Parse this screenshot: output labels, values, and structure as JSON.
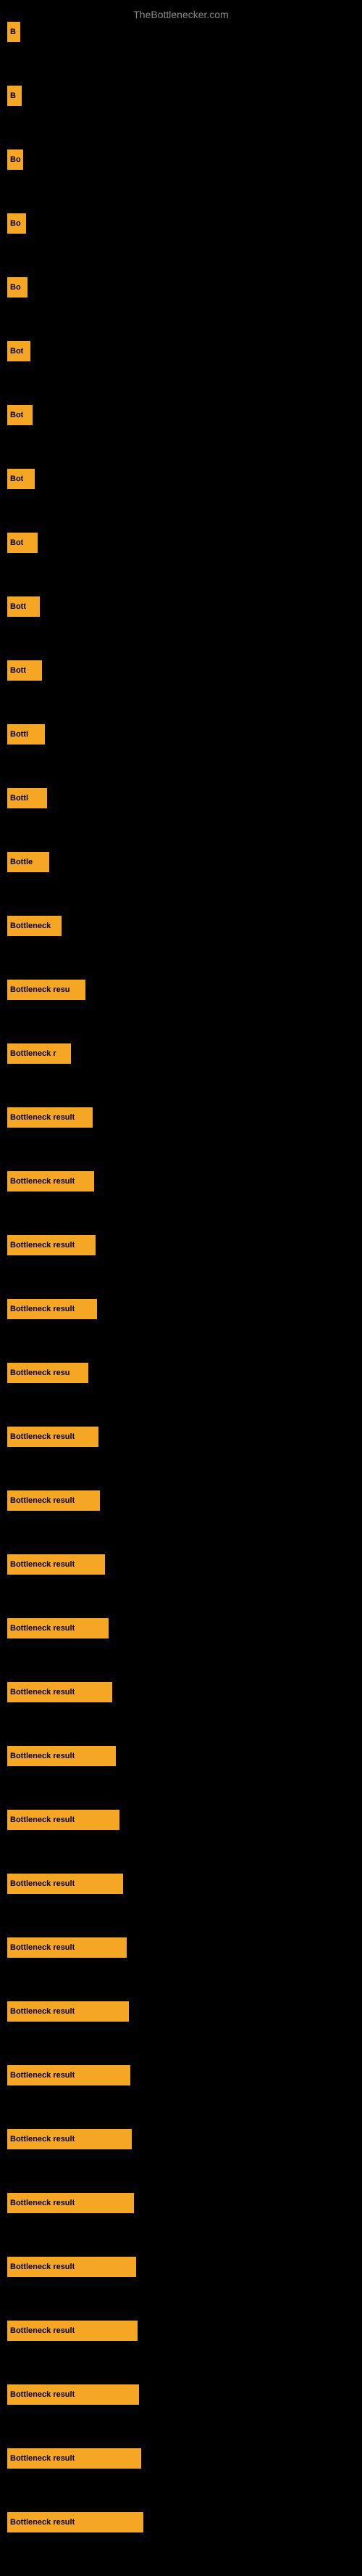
{
  "site": {
    "title": "TheBottlenecker.com"
  },
  "bars": [
    {
      "label": "B",
      "width": 18
    },
    {
      "label": "B",
      "width": 20
    },
    {
      "label": "Bo",
      "width": 22
    },
    {
      "label": "Bo",
      "width": 26
    },
    {
      "label": "Bo",
      "width": 28
    },
    {
      "label": "Bot",
      "width": 32
    },
    {
      "label": "Bot",
      "width": 35
    },
    {
      "label": "Bot",
      "width": 38
    },
    {
      "label": "Bot",
      "width": 42
    },
    {
      "label": "Bott",
      "width": 45
    },
    {
      "label": "Bott",
      "width": 48
    },
    {
      "label": "Bottl",
      "width": 52
    },
    {
      "label": "Bottl",
      "width": 55
    },
    {
      "label": "Bottle",
      "width": 58
    },
    {
      "label": "Bottleneck",
      "width": 75
    },
    {
      "label": "Bottleneck resu",
      "width": 108
    },
    {
      "label": "Bottleneck r",
      "width": 88
    },
    {
      "label": "Bottleneck result",
      "width": 118
    },
    {
      "label": "Bottleneck result",
      "width": 120
    },
    {
      "label": "Bottleneck result",
      "width": 122
    },
    {
      "label": "Bottleneck result",
      "width": 124
    },
    {
      "label": "Bottleneck resu",
      "width": 112
    },
    {
      "label": "Bottleneck result",
      "width": 126
    },
    {
      "label": "Bottleneck result",
      "width": 128
    },
    {
      "label": "Bottleneck result",
      "width": 135
    },
    {
      "label": "Bottleneck result",
      "width": 140
    },
    {
      "label": "Bottleneck result",
      "width": 145
    },
    {
      "label": "Bottleneck result",
      "width": 150
    },
    {
      "label": "Bottleneck result",
      "width": 155
    },
    {
      "label": "Bottleneck result",
      "width": 160
    },
    {
      "label": "Bottleneck result",
      "width": 165
    },
    {
      "label": "Bottleneck result",
      "width": 168
    },
    {
      "label": "Bottleneck result",
      "width": 170
    },
    {
      "label": "Bottleneck result",
      "width": 172
    },
    {
      "label": "Bottleneck result",
      "width": 175
    },
    {
      "label": "Bottleneck result",
      "width": 178
    },
    {
      "label": "Bottleneck result",
      "width": 180
    },
    {
      "label": "Bottleneck result",
      "width": 182
    },
    {
      "label": "Bottleneck result",
      "width": 185
    },
    {
      "label": "Bottleneck result",
      "width": 188
    }
  ]
}
